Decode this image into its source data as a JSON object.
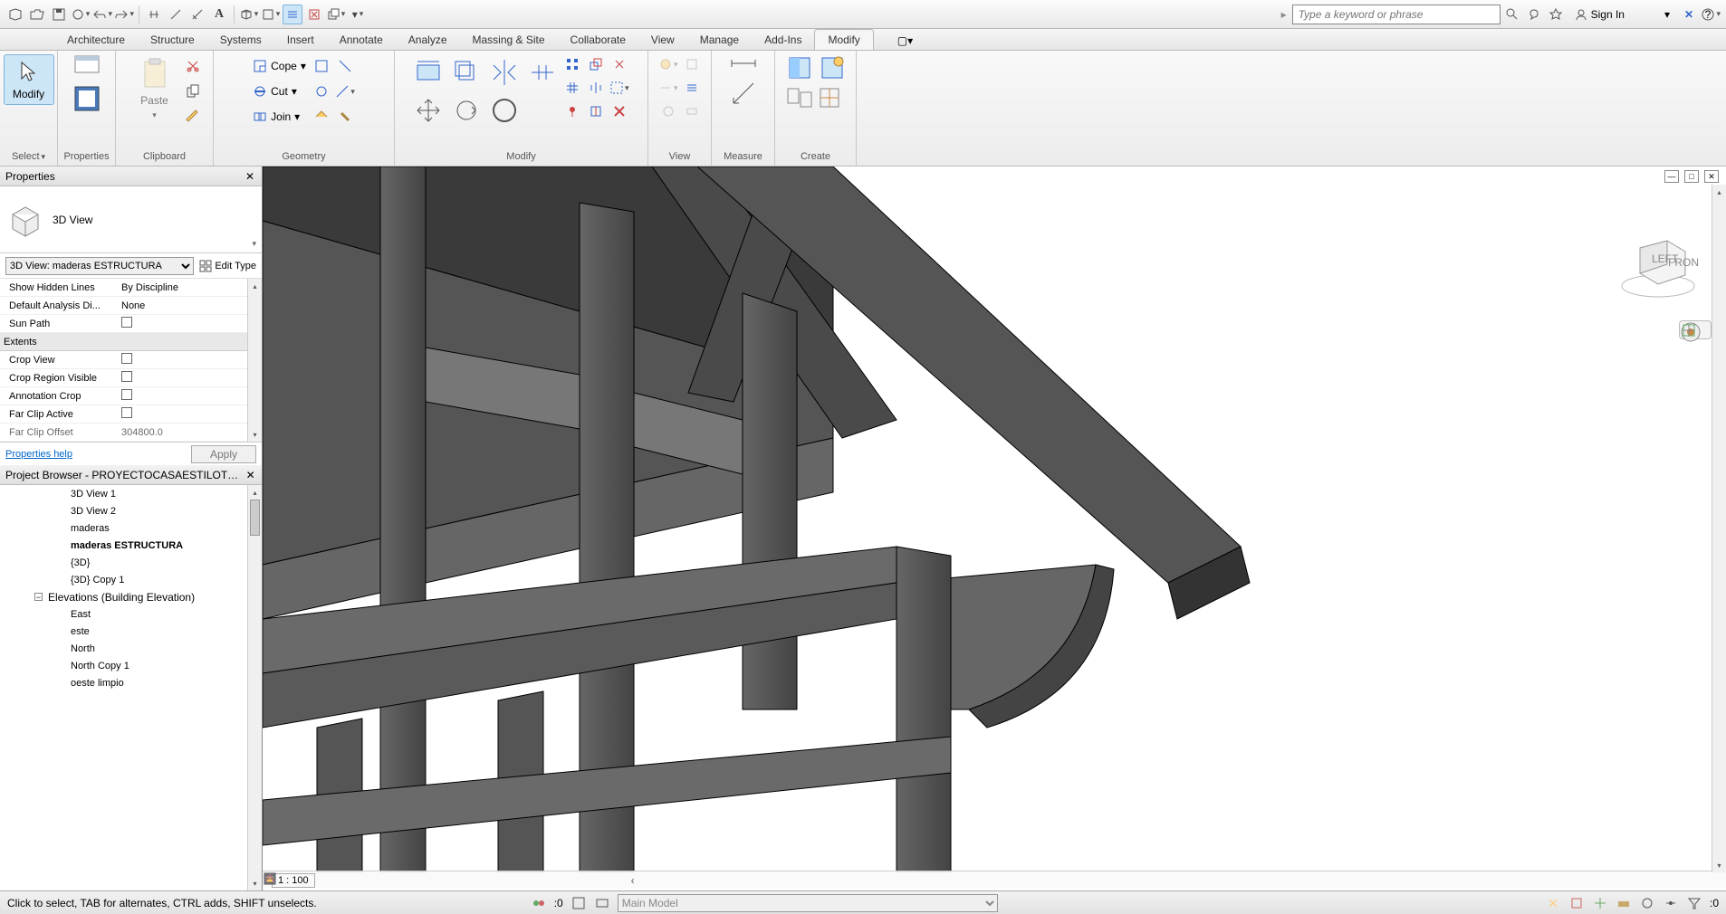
{
  "qat": {
    "search_placeholder": "Type a keyword or phrase",
    "signin": "Sign In"
  },
  "tabs": [
    "Architecture",
    "Structure",
    "Systems",
    "Insert",
    "Annotate",
    "Analyze",
    "Massing & Site",
    "Collaborate",
    "View",
    "Manage",
    "Add-Ins",
    "Modify"
  ],
  "active_tab": "Modify",
  "ribbon": {
    "select": {
      "btn": "Modify",
      "label": "Select"
    },
    "properties": "Properties",
    "clipboard": {
      "paste": "Paste",
      "label": "Clipboard"
    },
    "geometry": {
      "cope": "Cope",
      "cut": "Cut",
      "join": "Join",
      "label": "Geometry"
    },
    "modify": "Modify",
    "view": "View",
    "measure": "Measure",
    "create": "Create"
  },
  "props": {
    "title": "Properties",
    "type": "3D View",
    "instance": "3D View: maderas ESTRUCTURA",
    "edit_type": "Edit Type",
    "rows": [
      {
        "k": "Show Hidden Lines",
        "v": "By Discipline"
      },
      {
        "k": "Default Analysis Di...",
        "v": "None"
      },
      {
        "k": "Sun Path",
        "chk": true
      }
    ],
    "cat": "Extents",
    "rows2": [
      {
        "k": "Crop View",
        "chk": true
      },
      {
        "k": "Crop Region Visible",
        "chk": true
      },
      {
        "k": "Annotation Crop",
        "chk": true
      },
      {
        "k": "Far Clip Active",
        "chk": true
      },
      {
        "k": "Far Clip Offset",
        "v": "304800.0"
      }
    ],
    "help": "Properties help",
    "apply": "Apply"
  },
  "browser": {
    "title": "Project Browser - PROYECTOCASAESTILOTUDOR...",
    "views": [
      "3D View 1",
      "3D View 2",
      "maderas",
      "maderas ESTRUCTURA",
      "{3D}",
      "{3D} Copy 1"
    ],
    "active": "maderas ESTRUCTURA",
    "cat": "Elevations (Building Elevation)",
    "elev": [
      "East",
      "este",
      "North",
      "North Copy 1",
      "oeste limpio"
    ]
  },
  "viewctrl": {
    "scale": "1 : 100"
  },
  "viewcube": {
    "front": "FRONT",
    "left": "LEFT"
  },
  "status": {
    "hint": "Click to select, TAB for alternates, CTRL adds, SHIFT unselects.",
    "zero": ":0",
    "main_model": "Main Model"
  }
}
